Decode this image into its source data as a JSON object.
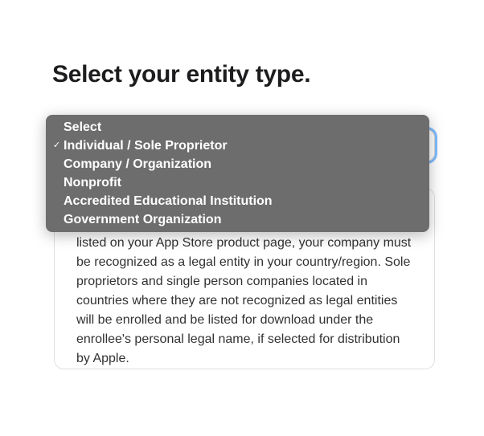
{
  "page": {
    "title": "Select your entity type."
  },
  "card": {
    "description": "listed on your App Store product page, your company must be recognized as a legal entity in your country/region. Sole proprietors and single person companies located in countries where they are not recognized as legal entities will be enrolled and be listed for download under the enrollee's personal legal name, if selected for distribution by Apple."
  },
  "dropdown": {
    "selected_index": 1,
    "options": [
      {
        "label": "Select"
      },
      {
        "label": "Individual / Sole Proprietor"
      },
      {
        "label": "Company / Organization"
      },
      {
        "label": "Nonprofit"
      },
      {
        "label": "Accredited Educational Institution"
      },
      {
        "label": "Government Organization"
      }
    ]
  }
}
